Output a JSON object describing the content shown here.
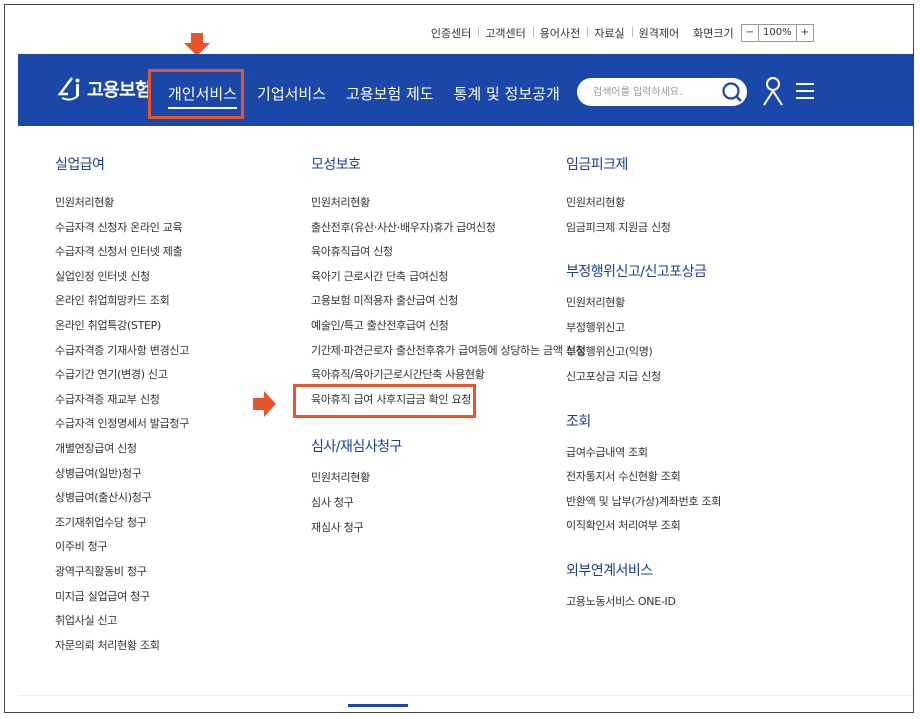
{
  "utility": {
    "links": [
      "인증센터",
      "고객센터",
      "용어사전",
      "자료실",
      "원격제어"
    ],
    "zoom_label": "화면크기",
    "zoom_minus": "−",
    "zoom_value": "100%",
    "zoom_plus": "+"
  },
  "header": {
    "logo_text": "고용보험",
    "nav": [
      "개인서비스",
      "기업서비스",
      "고용보험 제도",
      "통계 및 정보공개"
    ],
    "search_placeholder": "검색어를 입력하세요.",
    "brand_color": "#1b48a8",
    "highlight_color": "#e8542a"
  },
  "menu": {
    "col1": {
      "title": "실업급여",
      "items": [
        "민원처리현황",
        "수급자격 신청자 온라인 교육",
        "수급자격 신청서 인터넷 제출",
        "실업인정 인터넷 신청",
        "온라인 취업희망카드 조회",
        "온라인 취업특강(STEP)",
        "수급자격증 기재사항 변경신고",
        "수급기간 연기(변경) 신고",
        "수급자격증 재교부 신청",
        "수급자격 인정명세서 발급청구",
        "개별연장급여 신청",
        "상병급여(일반)청구",
        "상병급여(출산시)청구",
        "조기재취업수당 청구",
        "이주비 청구",
        "광역구직활동비 청구",
        "미지급 실업급여 청구",
        "취업사실 신고",
        "자문의뢰 처리현황 조회"
      ]
    },
    "col2": {
      "sections": [
        {
          "title": "모성보호",
          "items": [
            "민원처리현황",
            "출산전후(유산·사산·배우자)휴가 급여신청",
            "육아휴직급여 신청",
            "육아기 근로시간 단축 급여신청",
            "고용보험 미적용자 출산급여 신청",
            "예술인/특고 출산전후급여 신청",
            "기간제·파견근로자 출산전후휴가 급여등에 상당하는 금액 신청",
            "육아휴직/육아기근로시간단축 사용현황",
            "육아휴직 급여 사후지급금 확인 요청"
          ]
        },
        {
          "title": "심사/재심사청구",
          "items": [
            "민원처리현황",
            "심사 청구",
            "재심사 청구"
          ]
        }
      ]
    },
    "col3": {
      "sections": [
        {
          "title": "임금피크제",
          "items": [
            "민원처리현황",
            "임금피크제 지원금 신청"
          ]
        },
        {
          "title": "부정행위신고/신고포상금",
          "items": [
            "민원처리현황",
            "부정행위신고",
            "부정행위신고(익명)",
            "신고포상금 지급 신청"
          ]
        },
        {
          "title": "조회",
          "items": [
            "급여수급내역 조회",
            "전자통지서 수신현황 조회",
            "반환액 및 납부(가상)계좌번호 조회",
            "이직확인서 처리여부 조회"
          ]
        },
        {
          "title": "외부연계서비스",
          "items": [
            "고용노동서비스 ONE-ID"
          ]
        }
      ]
    }
  }
}
